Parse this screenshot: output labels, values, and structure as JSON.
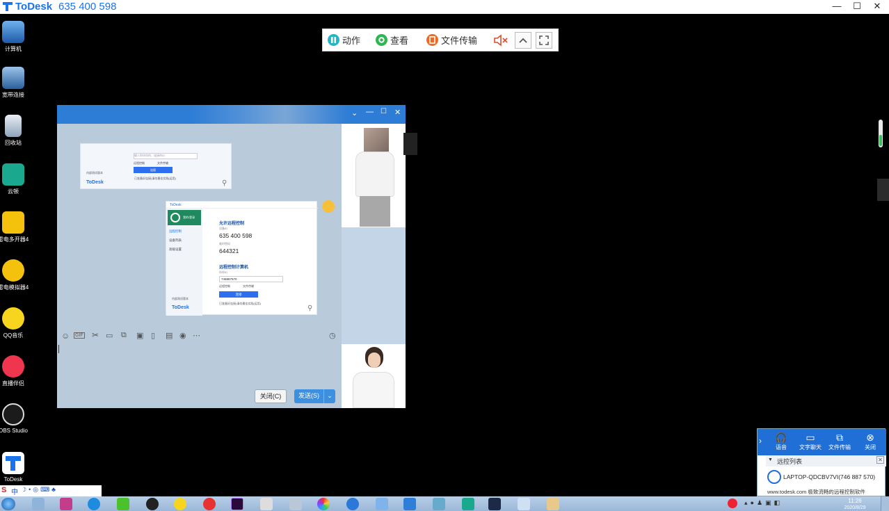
{
  "window": {
    "app_name": "ToDesk",
    "device_id": "635 400 598",
    "minimize": "—",
    "maximize": "☐",
    "close": "✕"
  },
  "remote_toolbar": {
    "action": "动作",
    "view": "查看",
    "file_transfer": "文件传输",
    "mute_icon": "speaker-muted-icon",
    "collapse_icon": "chevron-up-icon",
    "fullscreen_icon": "fullscreen-icon"
  },
  "desktop_icons": [
    "计算机",
    "宽带连接",
    "回收站",
    "云顿",
    "雷电多开器4",
    "雷电模拟器4",
    "QQ音乐",
    "直播伴侣",
    "OBS Studio",
    "ToDesk"
  ],
  "chat_window": {
    "inner_small": {
      "placeholder": "输入你伙伴的，连接的ID",
      "remote_control": "远程控制",
      "file_transfer": "文件传输",
      "connect": "连接",
      "status": "已准备好连接(请勿最佳实践(运用)",
      "version": "内部测试版本",
      "logo": "ToDesk"
    },
    "inner_large": {
      "title": "ToDesk",
      "user": "我的/登录",
      "nav_remote": "远程控制",
      "nav_devices": "设备列表",
      "nav_advanced": "高级设置",
      "allow_heading": "允许远程控制",
      "id_label": "设备ID",
      "device_id": "635 400 598",
      "pass_label": "临时密码",
      "password": "644321",
      "control_heading": "远程控制计算机",
      "partner_label": "伙伴ID",
      "partner_id": "746887570",
      "opt_remote": "远程控制",
      "opt_file": "文件传输",
      "connect": "连接",
      "status": "已准备好连接(请勿最佳实践(运用)",
      "version": "内部测试版本",
      "logo": "ToDesk"
    },
    "close_btn": "关闭(C)",
    "send_btn": "发送(S)"
  },
  "todesk_panel": {
    "voice": "语音",
    "text_chat": "文字聊天",
    "file_transfer": "文件传输",
    "close": "关闭",
    "list_title": "远控列表",
    "device": "LAPTOP-QDCBV7VI(746 887 570)",
    "footer": "www.todesk.com 极致流畅的远程控制软件"
  },
  "taskbar": {
    "time": "11:26",
    "date": "2020/8/29",
    "ime": "中"
  },
  "colors": {
    "brand": "#1a73e8",
    "panel_blue": "#1f6fd6",
    "chat_title": "#2d7cd5",
    "send_blue": "#3d8fe0"
  }
}
